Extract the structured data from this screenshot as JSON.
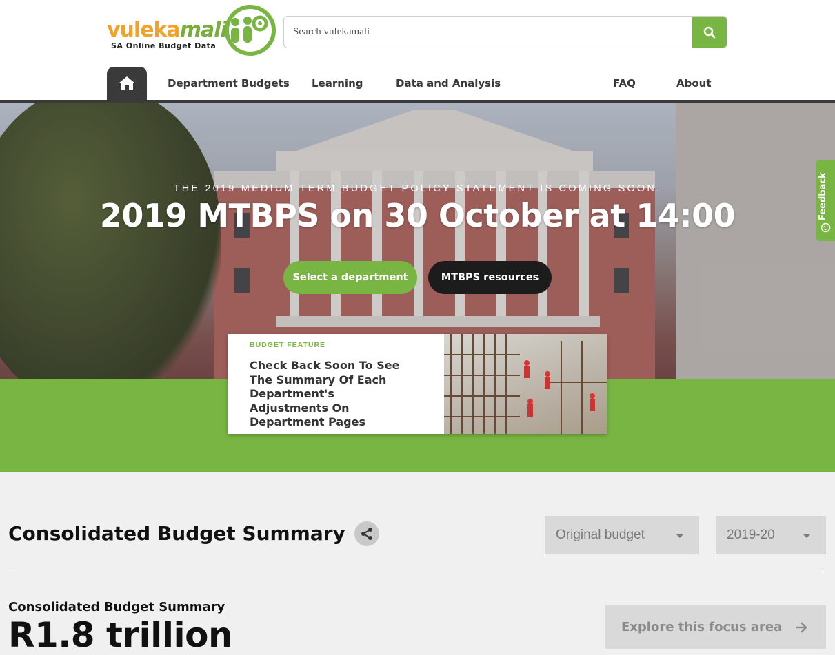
{
  "logo": {
    "word_part1": "vuleka",
    "word_part2": "mali",
    "tagline": "SA Online Budget Data",
    "brand_green": "#79b543",
    "brand_orange": "#f0a22a"
  },
  "search": {
    "placeholder": "Search vulekamali",
    "icon": "search-icon"
  },
  "nav": {
    "home_icon": "home-icon",
    "items": [
      {
        "label": "Department Budgets"
      },
      {
        "label": "Learning"
      },
      {
        "label": "Data and Analysis"
      },
      {
        "label": "FAQ"
      },
      {
        "label": "About"
      }
    ]
  },
  "hero": {
    "eyebrow": "THE 2019 MEDIUM TERM BUDGET POLICY STATEMENT IS COMING SOON.",
    "title": "2019 MTBPS on 30 October at 14:00",
    "primary_button": "Select a department",
    "secondary_button": "MTBPS resources"
  },
  "feature": {
    "eyebrow": "BUDGET FEATURE",
    "title": "Check Back Soon To See The Summary Of Each Department's Adjustments On Department Pages"
  },
  "feedback": {
    "label": "Feedback",
    "icon": "smiley-icon"
  },
  "summary": {
    "title": "Consolidated Budget Summary",
    "share_icon": "share-icon",
    "budget_type": "Original budget",
    "year": "2019-20",
    "sub_title": "Consolidated Budget Summary",
    "amount": "R1.8 trillion",
    "explore_label": "Explore this focus area",
    "explore_icon": "arrow-right-icon"
  }
}
